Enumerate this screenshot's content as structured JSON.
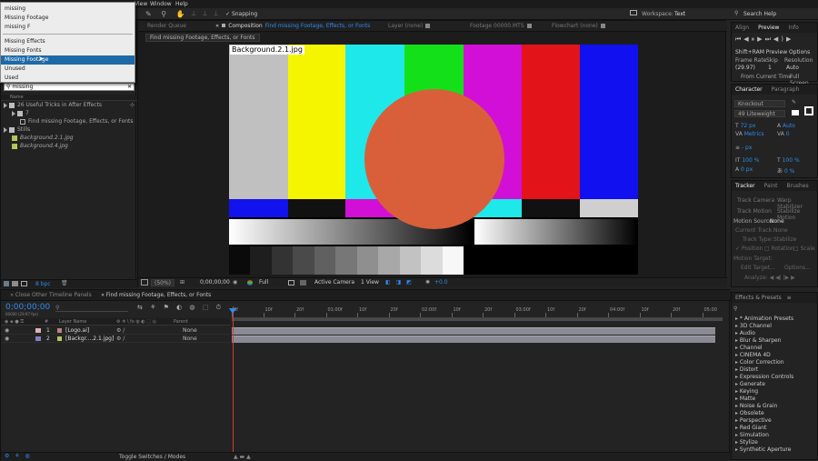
{
  "menubar": {
    "view": "View",
    "window": "Window",
    "help": "Help"
  },
  "toolbar": {
    "snapping": "Snapping",
    "workspace_label": "Workspace:",
    "workspace_value": "Text",
    "search_help": "Search Help"
  },
  "dropdown": {
    "items": [
      {
        "label": "missing",
        "selected": false
      },
      {
        "label": "Missing Footage",
        "selected": false
      },
      {
        "label": "missing F",
        "selected": false
      },
      {
        "label": "Missing Effects",
        "selected": false
      },
      {
        "label": "Missing Fonts",
        "selected": false
      },
      {
        "label": "Missing Footage",
        "selected": true
      },
      {
        "label": "Unused",
        "selected": false
      },
      {
        "label": "Used",
        "selected": false
      }
    ]
  },
  "project": {
    "search_value": "missing",
    "col_name": "Name",
    "tree": [
      {
        "label": "26 Useful Tricks in After Effects",
        "level": 0,
        "kind": "folder",
        "italic": false
      },
      {
        "label": "7",
        "level": 1,
        "kind": "folder",
        "italic": false
      },
      {
        "label": "Find missing Footage, Effects, or Fonts",
        "level": 2,
        "kind": "comp",
        "italic": false
      },
      {
        "label": "Stills",
        "level": 0,
        "kind": "folder",
        "italic": false
      },
      {
        "label": "Background.2.1.jpg",
        "level": 1,
        "kind": "image",
        "italic": true
      },
      {
        "label": "Background.4.jpg",
        "level": 1,
        "kind": "image",
        "italic": true
      }
    ],
    "bpc": "8 bpc"
  },
  "viewer": {
    "tabs": [
      {
        "label": "Render Queue",
        "active": false
      },
      {
        "label": "Composition",
        "accent": "Find missing Footage, Effects, or Fonts",
        "active": true
      },
      {
        "label": "Layer (none)",
        "active": false
      },
      {
        "label": "Footage 00000.MTS",
        "active": false
      },
      {
        "label": "Flowchart (none)",
        "active": false
      }
    ],
    "crumb": "Find missing Footage, Effects, or Fonts",
    "image_label": "Background.2.1.jpg",
    "bottom": {
      "zoom": "(50%)",
      "timecode": "0;00;00;00",
      "resolution": "Full",
      "camera": "Active Camera",
      "views": "1 View",
      "exposure": "+0.0"
    }
  },
  "preview": {
    "tabs": [
      "Align",
      "Preview",
      "Info"
    ],
    "options": "Shift+RAM Preview Options",
    "labels": [
      "Frame Rate",
      "Skip",
      "Resolution"
    ],
    "values": [
      "(29.97)",
      "1",
      "Auto"
    ],
    "from_current": "From Current Time",
    "full_screen": "Full Screen"
  },
  "character": {
    "tabs": [
      "Character",
      "Paragraph"
    ],
    "font": "Knockout",
    "style": "49 Liteweight",
    "size": "72 px",
    "tracking_value": "Metrics",
    "leading": "Auto",
    "kerning": "0",
    "stroke": "- px",
    "vscale": "100 %",
    "hscale": "100 %",
    "baseline": "0 px",
    "tsume": "0 %"
  },
  "tracker": {
    "tabs": [
      "Tracker",
      "Paint",
      "Brushes"
    ],
    "buttons": [
      [
        "Track Camera",
        "Warp Stabilizer"
      ],
      [
        "Track Motion",
        "Stabilize Motion"
      ]
    ],
    "motion_source_label": "Motion Source:",
    "motion_source_value": "None",
    "current_track_label": "Current Track:",
    "current_track_value": "None",
    "track_type_label": "Track Type:",
    "track_type_value": "Stabilize",
    "checks": [
      "Position",
      "Rotation",
      "Scale"
    ],
    "motion_target": "Motion Target:",
    "edit_target": "Edit Target...",
    "options": "Options...",
    "analyze": "Analyze:"
  },
  "timeline": {
    "tabs": [
      "Close Other Timeline Panels",
      "Find missing Footage, Effects, or Fonts"
    ],
    "timecode": "0;00;00;00",
    "fps": "00000 (29.97 fps)",
    "col_layer": "Layer Name",
    "col_parent": "Parent",
    "ruler": [
      "0f",
      "10f",
      "20f",
      "01:00f",
      "10f",
      "20f",
      "02:00f",
      "10f",
      "20f",
      "03:00f",
      "10f",
      "20f",
      "04:00f",
      "10f",
      "20f",
      "05:00"
    ],
    "layers": [
      {
        "num": "1",
        "name": "[Logo.ai]",
        "color": "#e0b0b0",
        "parent": "None"
      },
      {
        "num": "2",
        "name": "[Backgr....2.1.jpg]",
        "color": "#8080c0",
        "parent": "None"
      }
    ],
    "toggle": "Toggle Switches / Modes"
  },
  "effects": {
    "title": "Effects & Presets",
    "items": [
      "* Animation Presets",
      "3D Channel",
      "Audio",
      "Blur & Sharpen",
      "Channel",
      "CINEMA 4D",
      "Color Correction",
      "Distort",
      "Expression Controls",
      "Generate",
      "Keying",
      "Matte",
      "Noise & Grain",
      "Obsolete",
      "Perspective",
      "Red Giant",
      "Simulation",
      "Stylize",
      "Synthetic Aperture"
    ]
  },
  "colors": {
    "accent": "#2d8ceb",
    "selection": "#1e6aa8",
    "circle": "#d95f3b",
    "playhead": "#d83a3a"
  }
}
